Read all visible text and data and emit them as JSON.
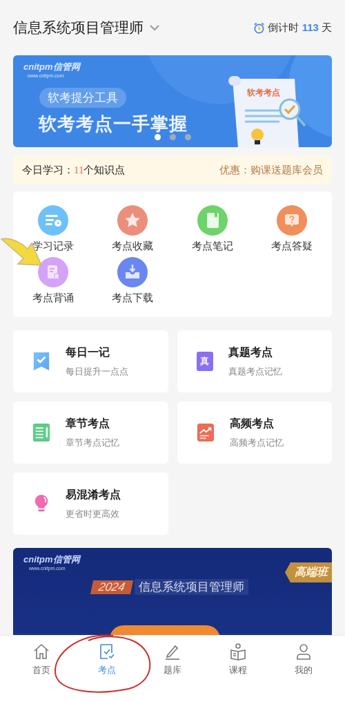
{
  "header": {
    "title": "信息系统项目管理师",
    "countdown_label": "倒计时",
    "countdown_days": "113",
    "countdown_unit": "天"
  },
  "banner": {
    "logo": "cnitpm信管网",
    "url": "www.cnitpm.com",
    "tag": "软考提分工具",
    "headline": "软考考点一手掌握",
    "doc_title": "软考考点",
    "dots": [
      {
        "selected": true
      },
      {
        "selected": false
      },
      {
        "selected": false
      }
    ]
  },
  "notice": {
    "study_label": "今日学习：",
    "study_count": "11",
    "study_unit": "个知识点",
    "promo": "优惠：购课送题库会员"
  },
  "tools": [
    {
      "label": "学习记录",
      "kind": "history",
      "color": "#6ec1f7"
    },
    {
      "label": "考点收藏",
      "kind": "star",
      "color": "#ec8e7c"
    },
    {
      "label": "考点笔记",
      "kind": "notebook",
      "color": "#6dd36a"
    },
    {
      "label": "考点答疑",
      "kind": "question",
      "color": "#ef8f5b"
    },
    {
      "label": "考点背诵",
      "kind": "recite",
      "color": "#d3a3f7"
    },
    {
      "label": "考点下载",
      "kind": "download",
      "color": "#6a86f0"
    }
  ],
  "cards": [
    {
      "title": "每日一记",
      "subtitle": "每日提升一点点",
      "kind": "ribbon"
    },
    {
      "title": "真题考点",
      "subtitle": "真题考点记忆",
      "kind": "clipboard",
      "icon_text": "真"
    },
    {
      "title": "章节考点",
      "subtitle": "章节考点记忆",
      "kind": "list"
    },
    {
      "title": "高频考点",
      "subtitle": "高频考点记忆",
      "kind": "chart"
    },
    {
      "title": "易混淆考点",
      "subtitle": "更省时更高效",
      "kind": "bulb"
    }
  ],
  "promo_banner": {
    "logo": "cnitpm信管网",
    "url": "www.cnitpm.com",
    "year": "2024",
    "subtitle": "信息系统项目管理师",
    "badge": "高端班"
  },
  "tabs": [
    {
      "label": "首页",
      "kind": "home",
      "selected": false
    },
    {
      "label": "考点",
      "kind": "points",
      "selected": true
    },
    {
      "label": "题库",
      "kind": "pen",
      "selected": false
    },
    {
      "label": "课程",
      "kind": "course",
      "selected": false
    },
    {
      "label": "我的",
      "kind": "user",
      "selected": false
    }
  ],
  "annotations": [
    {
      "kind": "arrow"
    },
    {
      "kind": "circle"
    }
  ]
}
